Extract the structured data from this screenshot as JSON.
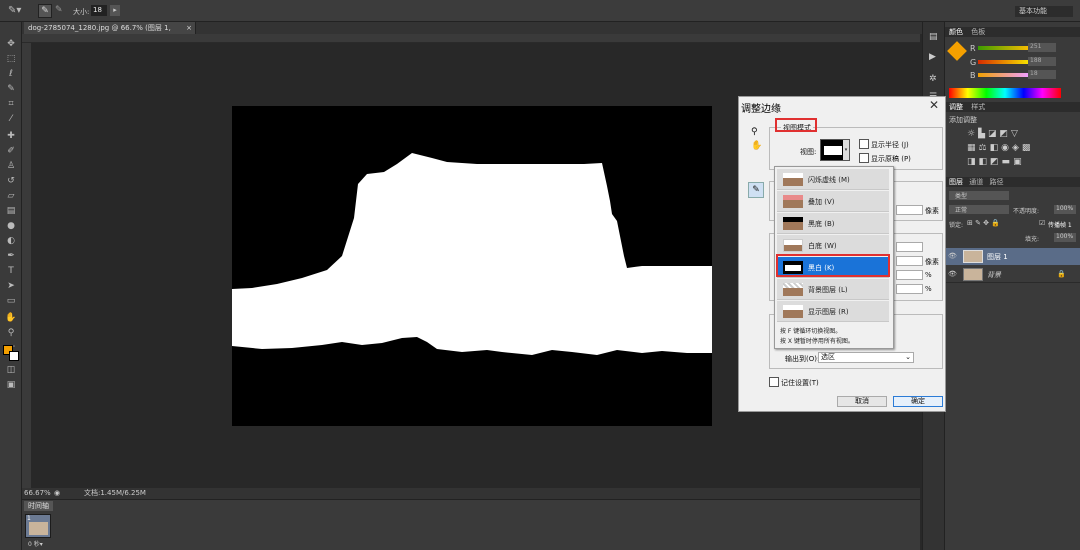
{
  "options_bar": {
    "size_label": "大小:",
    "size_value": "18",
    "workspace": "基本功能"
  },
  "document": {
    "tab_title": "dog-2785074_1280.jpg @ 66.7% (图层 1, RGB/8#) *",
    "tab_close": "×"
  },
  "status": {
    "zoom": "66.67%",
    "doc_size": "文档:1.45M/6.25M"
  },
  "timeline": {
    "title": "时间轴",
    "frame_delay": "0 秒▾",
    "frame_number": "1"
  },
  "panels": {
    "color_tab": "颜色",
    "swatches_tab": "色板",
    "rgb": {
      "r_label": "R",
      "g_label": "G",
      "b_label": "B",
      "r": "251",
      "g": "188",
      "b": "18"
    },
    "adjust_tab": "调整",
    "styles_tab": "样式",
    "adjust_hint": "添加调整",
    "layers_tab": "图层",
    "channels_tab": "通道",
    "paths_tab": "路径",
    "kind_label": "类型",
    "blend_mode": "正常",
    "opacity_label": "不透明度:",
    "opacity": "100%",
    "lock_label": "锁定:",
    "fill_label": "填充:",
    "fill": "100%",
    "propagate_label": "传播帧 1",
    "layers": [
      {
        "name": "图层 1"
      },
      {
        "name": "背景"
      }
    ]
  },
  "dialog": {
    "title": "调整边缘",
    "view_mode_label": "视图模式",
    "view_label": "视图:",
    "show_radius": "显示半径 (J)",
    "show_original": "显示原稿 (P)",
    "unit_px": "像素",
    "unit_px2": "像素",
    "unit_pct": "%",
    "unit_pct2": "%",
    "output_to_label": "输出到(O):",
    "output_to_value": "选区",
    "remember": "记住设置(T)",
    "cancel": "取消",
    "ok": "确定",
    "view_menu": {
      "items": [
        {
          "label": "闪烁虚线 (M)"
        },
        {
          "label": "叠加 (V)"
        },
        {
          "label": "黑底 (B)"
        },
        {
          "label": "白底 (W)"
        },
        {
          "label": "黑白 (K)"
        },
        {
          "label": "背景图层 (L)"
        },
        {
          "label": "显示图层 (R)"
        }
      ],
      "hint1": "按 F 键循环切换视图。",
      "hint2": "按 X 键暂时停用所有视图。"
    }
  },
  "colors": {
    "foreground": "#f5a000",
    "background": "#ffffff",
    "highlight": "#1a73d8",
    "callout": "#e03030"
  }
}
